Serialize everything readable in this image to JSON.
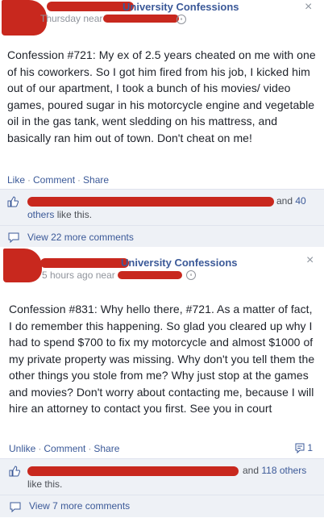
{
  "post1": {
    "page_name": "University Confessions",
    "timestamp": "Thursday near",
    "confession": "Confession #721: My ex of 2.5 years cheated on me with one of his coworkers. So I got him fired from his job, I kicked him out of our apartment, I took a bunch of his movies/ video games, poured sugar in his motorcycle engine and vegetable oil in the gas tank, went sledding on his mattress, and basically ran him out of town. Don't cheat on me!",
    "actions": {
      "like": "Like",
      "comment": "Comment",
      "share": "Share"
    },
    "likes": {
      "and_text": "and",
      "count": "40",
      "others_text": "others",
      "suffix": "like this."
    },
    "view_comments": "View 22 more comments"
  },
  "post2": {
    "page_name": "University Confessions",
    "timestamp": "5 hours ago near",
    "confession": "Confession #831: Why hello there, #721. As a matter of fact, I do remember this happening. So glad you cleared up why I had to spend $700 to fix my motorcycle and almost $1000 of my private property was missing. Why don't you tell them the other things you stole from me? Why just stop at the games and movies? Don't worry about contacting me, because I will hire an attorney to contact you first. See you in court",
    "actions": {
      "unlike": "Unlike",
      "comment": "Comment",
      "share": "Share"
    },
    "share_count": "1",
    "likes": {
      "and_text": "and",
      "count": "118",
      "others_text": "others",
      "suffix": "like this."
    },
    "view_comments": "View 7 more comments"
  },
  "close_icon": "×",
  "colors": {
    "link": "#3b5998",
    "redaction": "#c8281e",
    "feedback_bg": "#eef1f6"
  }
}
